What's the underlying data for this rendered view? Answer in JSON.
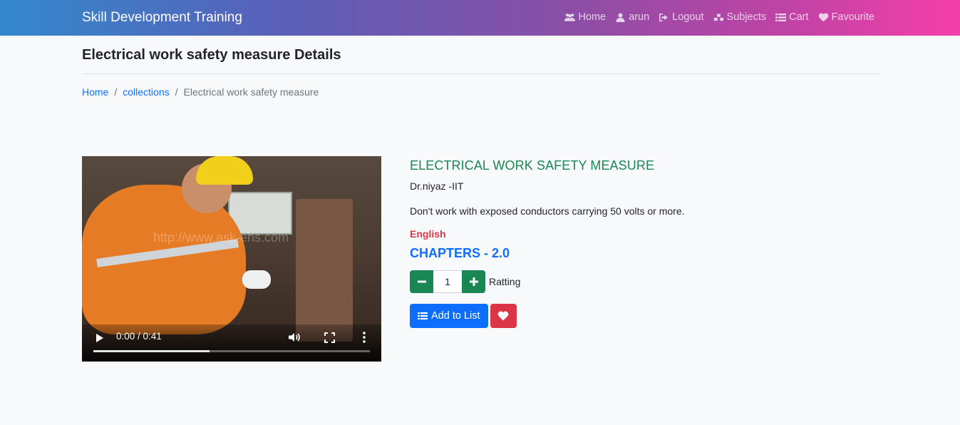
{
  "navbar": {
    "brand": "Skill Development Training",
    "links": [
      {
        "label": "Home",
        "icon": "users-icon"
      },
      {
        "label": "arun",
        "icon": "user-icon"
      },
      {
        "label": "Logout",
        "icon": "sign-out-icon"
      },
      {
        "label": "Subjects",
        "icon": "cubes-icon"
      },
      {
        "label": "Cart",
        "icon": "list-icon"
      },
      {
        "label": "Favourite",
        "icon": "heart-icon"
      }
    ]
  },
  "page": {
    "title": "Electrical work safety measure Details"
  },
  "breadcrumb": {
    "items": [
      "Home",
      "collections"
    ],
    "separator": "/",
    "active": "Electrical work safety measure"
  },
  "video": {
    "time": "0:00 / 0:41",
    "buffered": 0.42,
    "watermark": "http://www.ask-ehs.com"
  },
  "course": {
    "title": "ELECTRICAL WORK SAFETY MEASURE",
    "author": "Dr.niyaz -IIT",
    "description": "Don't work with exposed conductors carrying 50 volts or more.",
    "language": "English",
    "chapters": "CHAPTERS - 2.0",
    "quantity": "1",
    "rating_label": "Ratting",
    "add_button": "Add to List"
  },
  "colors": {
    "success": "#198754",
    "primary": "#0d6efd",
    "danger": "#dc3545",
    "navbar_gradient_start": "#3388cc",
    "navbar_gradient_end": "#f43fa8"
  }
}
